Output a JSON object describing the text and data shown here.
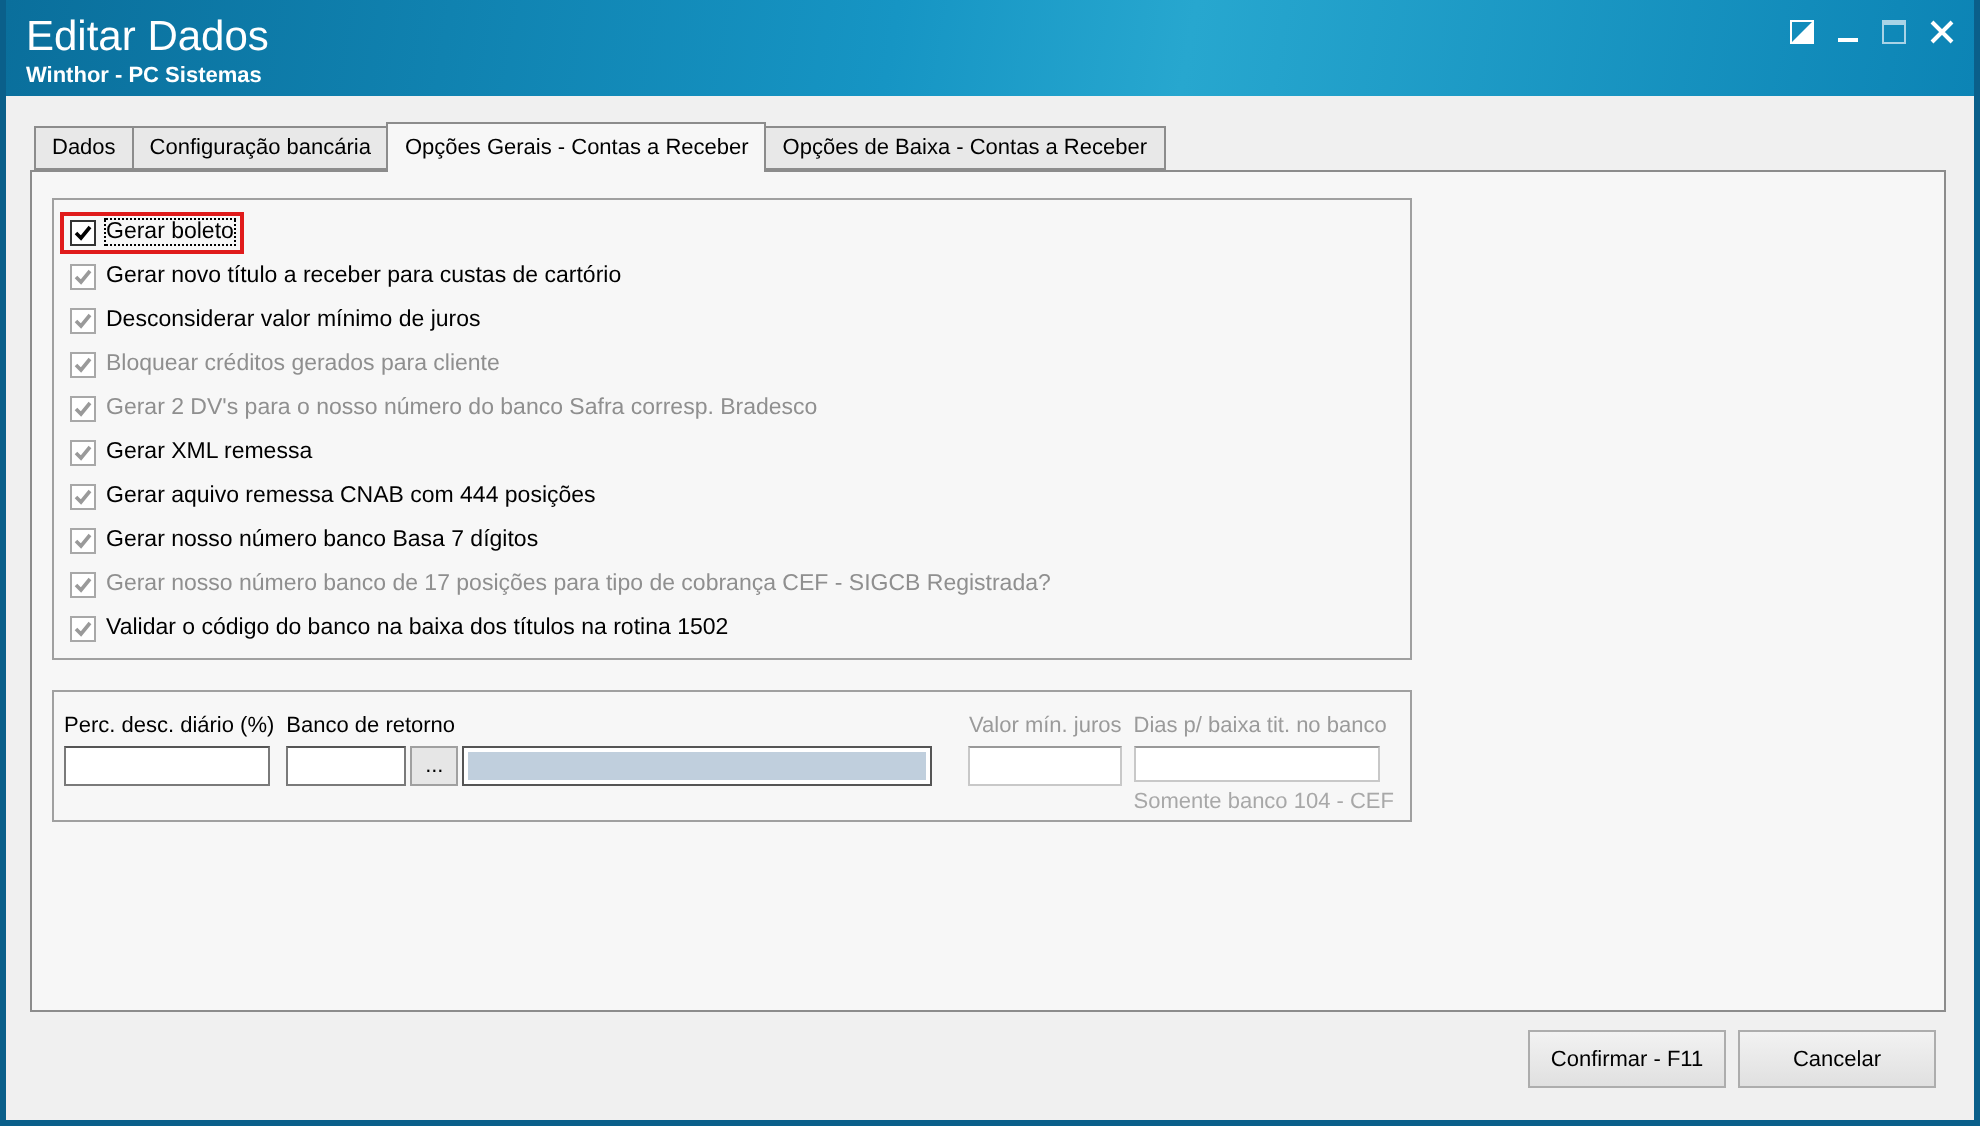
{
  "window": {
    "title": "Editar Dados",
    "subtitle": "Winthor - PC Sistemas"
  },
  "tabs": [
    {
      "label": "Dados",
      "selected": false
    },
    {
      "label": "Configuração bancária",
      "selected": false
    },
    {
      "label": "Opções Gerais - Contas a Receber",
      "selected": true
    },
    {
      "label": "Opções de Baixa - Contas a Receber",
      "selected": false
    }
  ],
  "options": [
    {
      "label": "Gerar boleto",
      "checked": true,
      "disabled": false,
      "focused": true,
      "highlighted": true
    },
    {
      "label": "Gerar novo título a receber para custas de cartório",
      "checked": true,
      "disabled": false,
      "focused": false,
      "highlighted": false
    },
    {
      "label": "Desconsiderar valor mínimo de juros",
      "checked": true,
      "disabled": false,
      "focused": false,
      "highlighted": false
    },
    {
      "label": "Bloquear créditos gerados para cliente",
      "checked": true,
      "disabled": true,
      "focused": false,
      "highlighted": false
    },
    {
      "label": "Gerar 2 DV's para o nosso número do banco Safra corresp. Bradesco",
      "checked": true,
      "disabled": true,
      "focused": false,
      "highlighted": false
    },
    {
      "label": "Gerar XML remessa",
      "checked": true,
      "disabled": false,
      "focused": false,
      "highlighted": false
    },
    {
      "label": "Gerar aquivo remessa CNAB com 444 posições",
      "checked": true,
      "disabled": false,
      "focused": false,
      "highlighted": false
    },
    {
      "label": "Gerar nosso número banco Basa 7 dígitos",
      "checked": true,
      "disabled": false,
      "focused": false,
      "highlighted": false
    },
    {
      "label": "Gerar nosso número banco de 17 posições para tipo de cobrança CEF - SIGCB Registrada?",
      "checked": true,
      "disabled": true,
      "focused": false,
      "highlighted": false
    },
    {
      "label": "Validar o código do banco na baixa dos títulos na rotina 1502",
      "checked": true,
      "disabled": false,
      "focused": false,
      "highlighted": false
    }
  ],
  "fields": [
    {
      "kind": "text",
      "label": "Perc. desc. diário (%)",
      "disabled": false
    },
    {
      "kind": "lookup",
      "label": "Banco de retorno",
      "disabled": false,
      "button": "..."
    },
    {
      "kind": "text",
      "label": "Valor mín. juros",
      "disabled": true
    },
    {
      "kind": "text",
      "label": "Dias p/ baixa tit. no banco",
      "disabled": true,
      "note": "Somente banco 104 - CEF"
    }
  ],
  "buttons": [
    "Confirmar - F11",
    "Cancelar"
  ]
}
